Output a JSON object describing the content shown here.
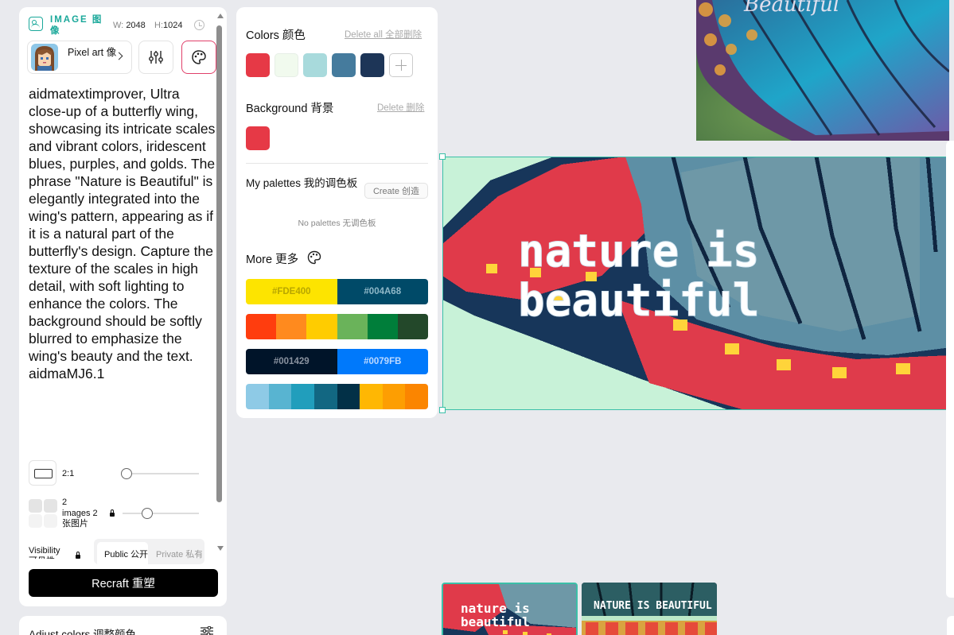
{
  "image_panel": {
    "header_label": "IMAGE 图像",
    "width_key": "W:",
    "width_value": "2048",
    "height_key": "H:",
    "height_value": "1024",
    "style_name": "Pixel art 像素...",
    "prompt": "aidmatextimprover, Ultra close-up of a butterfly wing, showcasing its intricate scales and vibrant colors, iridescent blues, purples, and golds. The phrase \"Nature is Beautiful\" is elegantly integrated into the wing's pattern, appearing as if it is a natural part of the butterfly's design. Capture the texture of the scales in high detail, with soft lighting to enhance the colors. The background should be softly blurred to emphasize the wing's beauty and the text. aidmaMJ6.1",
    "aspect_ratio": "2:1",
    "image_count": "2",
    "image_count_label": "images 2 张图片",
    "visibility_label": "Visibility 可见性",
    "visibility_public": "Public 公开",
    "visibility_private": "Private 私有",
    "recraft_button": "Recraft  重塑",
    "adjust_colors": "Adjust colors 调整颜色"
  },
  "colors_panel": {
    "colors_title": "Colors 颜色",
    "delete_all": "Delete all 全部删除",
    "swatches": [
      "#e63946",
      "#f1faee",
      "#a8dadc",
      "#457b9d",
      "#1d3557"
    ],
    "background_title": "Background 背景",
    "delete": "Delete 删除",
    "background_color": "#e63946",
    "my_palettes_title": "My palettes 我的调色板",
    "create_button": "Create  创造",
    "no_palettes": "No palettes 无调色板",
    "more_title": "More  更多",
    "palettes": [
      {
        "colors": [
          "#FDE400",
          "#004A68"
        ],
        "labels": [
          "#FDE400",
          "#004A68"
        ],
        "text_colors": [
          "#b8a600",
          "#8fb8c8"
        ]
      },
      {
        "colors": [
          "#FF3D0E",
          "#FF8A1E",
          "#FFCC00",
          "#6AB35A",
          "#007E3A",
          "#23482A"
        ],
        "labels": []
      },
      {
        "colors": [
          "#001429",
          "#0079FB"
        ],
        "labels": [
          "#001429",
          "#0079FB"
        ],
        "text_colors": [
          "#8a93a0",
          "#bcd9ff"
        ]
      },
      {
        "colors": [
          "#8ECAE6",
          "#58B4D1",
          "#219EBC",
          "#126782",
          "#023047",
          "#FFB703",
          "#FD9E02",
          "#FB8500"
        ],
        "labels": []
      }
    ]
  },
  "canvas": {
    "main_image_text": [
      "nature is",
      "beautiful"
    ],
    "top_image_text": "Beautiful",
    "thumb_1_text": [
      "nature is",
      "beautiful"
    ],
    "thumb_2_text": "NATURE IS BEAUTIFUL"
  }
}
